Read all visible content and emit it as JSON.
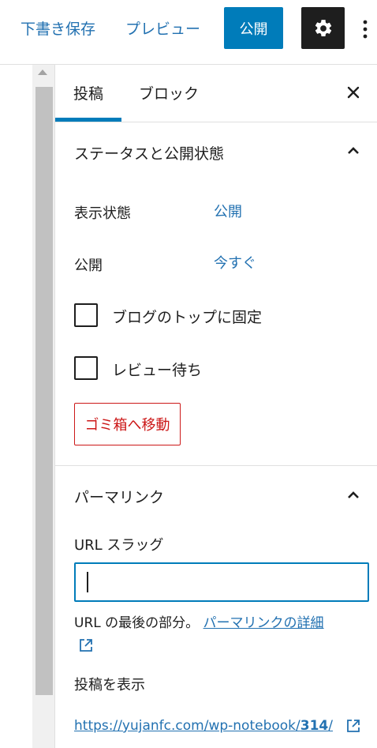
{
  "toolbar": {
    "save_draft": "下書き保存",
    "preview": "プレビュー",
    "publish": "公開",
    "settings_icon": "gear-icon",
    "more_icon": "vertical-ellipsis-icon"
  },
  "sidebar": {
    "tabs": [
      {
        "label": "投稿",
        "active": true
      },
      {
        "label": "ブロック",
        "active": false
      }
    ],
    "close_icon": "close-icon"
  },
  "status_panel": {
    "title": "ステータスと公開状態",
    "expanded": true,
    "visibility_label": "表示状態",
    "visibility_value": "公開",
    "publish_label": "公開",
    "publish_value": "今すぐ",
    "sticky_label": "ブログのトップに固定",
    "sticky_checked": false,
    "pending_label": "レビュー待ち",
    "pending_checked": false,
    "trash_button": "ゴミ箱へ移動"
  },
  "permalink_panel": {
    "title": "パーマリンク",
    "expanded": true,
    "slug_label": "URL スラッグ",
    "slug_value": "",
    "help_text": "URL の最後の部分。",
    "help_link": "パーマリンクの詳細",
    "view_label": "投稿を表示",
    "view_url_prefix": "https://yujanfc.com/wp-notebook/",
    "view_url_id": "314",
    "view_url_suffix": "/"
  },
  "colors": {
    "accent": "#007cba",
    "link": "#2271b1",
    "danger": "#cc1818",
    "dark": "#1e1e1e"
  }
}
